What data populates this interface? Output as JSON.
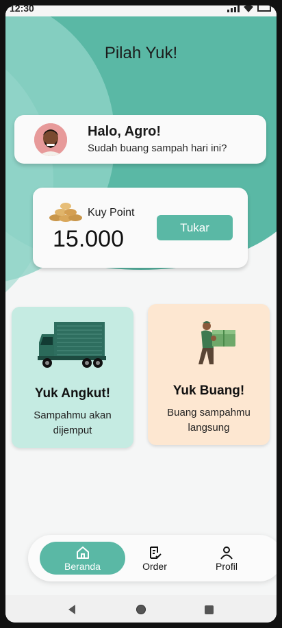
{
  "status_bar": {
    "time": "12:30"
  },
  "header": {
    "title": "Pilah Yuk!"
  },
  "greeting": {
    "name": "Halo, Agro!",
    "subtitle": "Sudah buang sampah hari ini?"
  },
  "points": {
    "label": "Kuy Point",
    "value": "15.000",
    "button_label": "Tukar"
  },
  "features": [
    {
      "title": "Yuk Angkut!",
      "description": "Sampahmu akan dijemput",
      "icon": "truck-illustration"
    },
    {
      "title": "Yuk Buang!",
      "description": "Buang sampahmu langsung",
      "icon": "man-carrying-box-illustration"
    }
  ],
  "bottom_nav": [
    {
      "label": "Beranda",
      "icon": "home-icon",
      "active": true
    },
    {
      "label": "Order",
      "icon": "order-icon",
      "active": false
    },
    {
      "label": "Profil",
      "icon": "profile-icon",
      "active": false
    }
  ],
  "colors": {
    "primary": "#5ab8a5",
    "card_green": "#c5ebe2",
    "card_orange": "#fde7d1"
  }
}
